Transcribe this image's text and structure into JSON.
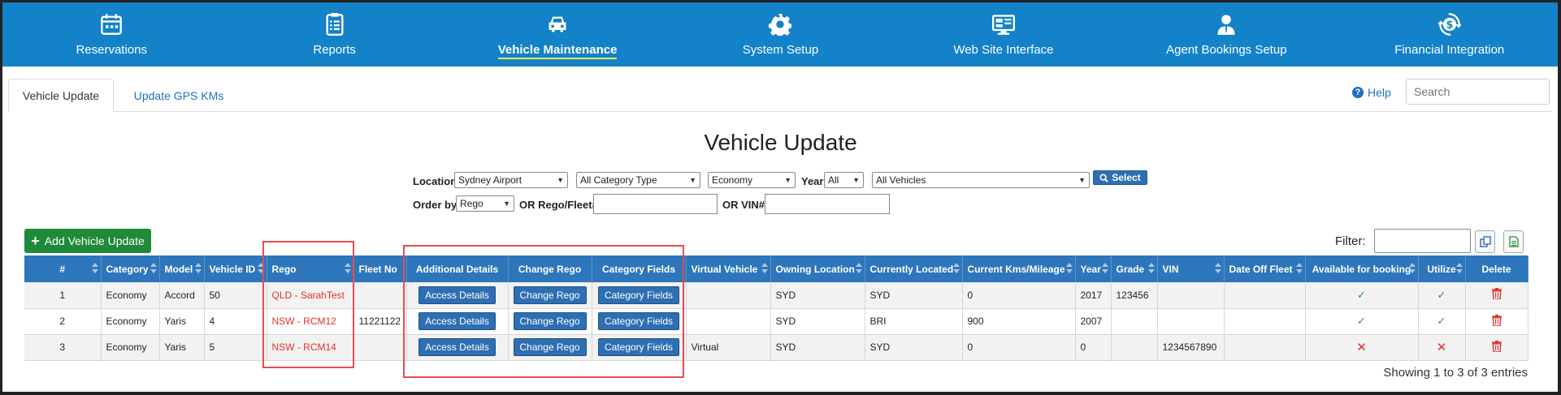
{
  "nav": [
    {
      "label": "Reservations",
      "icon": "calendar-icon"
    },
    {
      "label": "Reports",
      "icon": "checklist-icon"
    },
    {
      "label": "Vehicle Maintenance",
      "icon": "car-icon",
      "active": true
    },
    {
      "label": "System Setup",
      "icon": "gear-icon"
    },
    {
      "label": "Web Site Interface",
      "icon": "monitor-icon"
    },
    {
      "label": "Agent Bookings Setup",
      "icon": "agent-icon"
    },
    {
      "label": "Financial Integration",
      "icon": "dollar-cycle-icon"
    }
  ],
  "tabs": {
    "active": "Vehicle Update",
    "other": "Update GPS KMs"
  },
  "help": {
    "label": "Help",
    "icon": "question-circle-icon"
  },
  "search": {
    "placeholder": "Search"
  },
  "title": "Vehicle Update",
  "filters": {
    "location_label": "Location",
    "location": "Sydney Airport",
    "category_type": "All Category Type",
    "category": "Economy",
    "year_label": "Year",
    "year": "All",
    "vehicles": "All Vehicles",
    "select_label": "Select",
    "order_by_label": "Order by",
    "order_by": "Rego",
    "rego_fleet_label": "OR Rego/Fleet#",
    "vin_label": "OR VIN#"
  },
  "add_button": "Add Vehicle Update",
  "filter_label": "Filter:",
  "table": {
    "columns": [
      "#",
      "Category",
      "Model",
      "Vehicle ID",
      "Rego",
      "Fleet No",
      "Additional Details",
      "Change Rego",
      "Category Fields",
      "Virtual Vehicle",
      "Owning Location",
      "Currently Located",
      "Current Kms/Mileage",
      "Year",
      "Grade",
      "VIN",
      "Date Off Fleet",
      "Available for booking",
      "Utilize",
      "Delete"
    ],
    "action_labels": {
      "details": "Access Details",
      "rego": "Change Rego",
      "fields": "Category Fields"
    },
    "rows": [
      {
        "num": "1",
        "category": "Economy",
        "model": "Accord",
        "vehicle_id": "50",
        "rego": "QLD - SarahTest",
        "fleet_no": "",
        "virtual": "",
        "owning": "SYD",
        "located": "SYD",
        "kms": "0",
        "year": "2017",
        "grade": "123456",
        "vin": "",
        "date_off": "",
        "available": true,
        "utilize": true
      },
      {
        "num": "2",
        "category": "Economy",
        "model": "Yaris",
        "vehicle_id": "4",
        "rego": "NSW - RCM12",
        "fleet_no": "11221122",
        "virtual": "",
        "owning": "SYD",
        "located": "BRI",
        "kms": "900",
        "year": "2007",
        "grade": "",
        "vin": "",
        "date_off": "",
        "available": true,
        "utilize": true
      },
      {
        "num": "3",
        "category": "Economy",
        "model": "Yaris",
        "vehicle_id": "5",
        "rego": "NSW - RCM14",
        "fleet_no": "",
        "virtual": "Virtual",
        "owning": "SYD",
        "located": "SYD",
        "kms": "0",
        "year": "0",
        "grade": "",
        "vin": "1234567890",
        "date_off": "",
        "available": false,
        "utilize": false
      }
    ]
  },
  "showing": "Showing 1 to 3 of 3 entries",
  "colors": {
    "nav_bg": "#1382c8",
    "header_bg": "#2e76bb",
    "add_green": "#1f8a3a",
    "rego_red": "#e0312b",
    "highlight": "#e84c4c"
  }
}
